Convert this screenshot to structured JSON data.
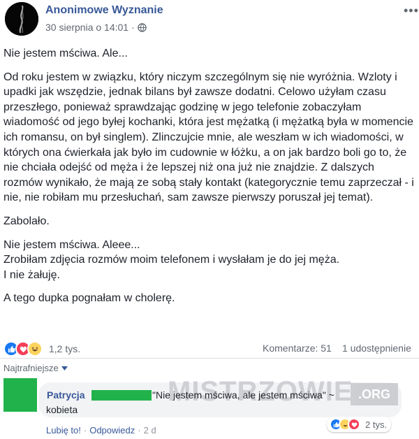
{
  "post": {
    "author": "Anonimowe Wyznanie",
    "date": "30 sierpnia o 14:01",
    "separator": "·",
    "privacy_icon": "globe-icon",
    "more_icon": "more-options-icon",
    "paragraphs": [
      "Nie jestem mściwa. Ale...",
      "Od roku jestem w związku, który niczym szczególnym się nie wyróżnia. Wzloty i upadki jak wszędzie, jednak bilans był zawsze dodatni. Celowo użyłam czasu przeszłego, ponieważ sprawdzając godzinę w jego telefonie zobaczyłam wiadomość od jego byłej kochanki, która jest mężatką (i mężatką była w momencie ich romansu, on był singlem). Zlinczujcie mnie, ale weszłam w ich wiadomości, w których ona ćwierkała jak było im cudownie w łóżku, a on jak bardzo boli go to, że nie chciała odejść od męża i że lepszej niż ona już nie znajdzie. Z dalszych rozmów wynikało, że mają ze sobą stały kontakt (kategorycznie temu zaprzeczał - i nie, nie robiłam mu przesłuchań, sam zawsze pierwszy poruszał jej temat).",
      "Zabolało.",
      "Nie jestem mściwa. Aleee...\nZrobiłam zdjęcia rozmów moim telefonem i wysłałam je do jej męża.\nI nie żałuję.",
      "A tego dupka pognałam w cholerę."
    ]
  },
  "stats": {
    "reaction_icons": [
      "like-icon",
      "love-icon",
      "haha-icon"
    ],
    "reaction_count": "1,2 tys.",
    "comments": "Komentarze: 51",
    "shares": "1 udostępnienie"
  },
  "sort_label": "Najtrafniejsze",
  "comment": {
    "author": "Patrycja",
    "text_line1": "\"Nie jestem mściwa, ale jestem mściwa\" ~",
    "text_line2": "kobieta",
    "like_label": "Lubię to!",
    "reply_label": "Odpowiedz",
    "separator": "·",
    "time": "2 d",
    "reaction_icons": [
      "like-icon",
      "haha-icon",
      "love-icon"
    ],
    "reaction_count": "2 tys."
  },
  "watermark": {
    "text": "MISTRZOWIE",
    "tld": ".ORG"
  },
  "colors": {
    "link_blue": "#385898",
    "redaction_green": "#21b24b",
    "like_blue": "#1877f2",
    "love_red": "#f33e58",
    "haha_yellow": "#fcd35d"
  }
}
